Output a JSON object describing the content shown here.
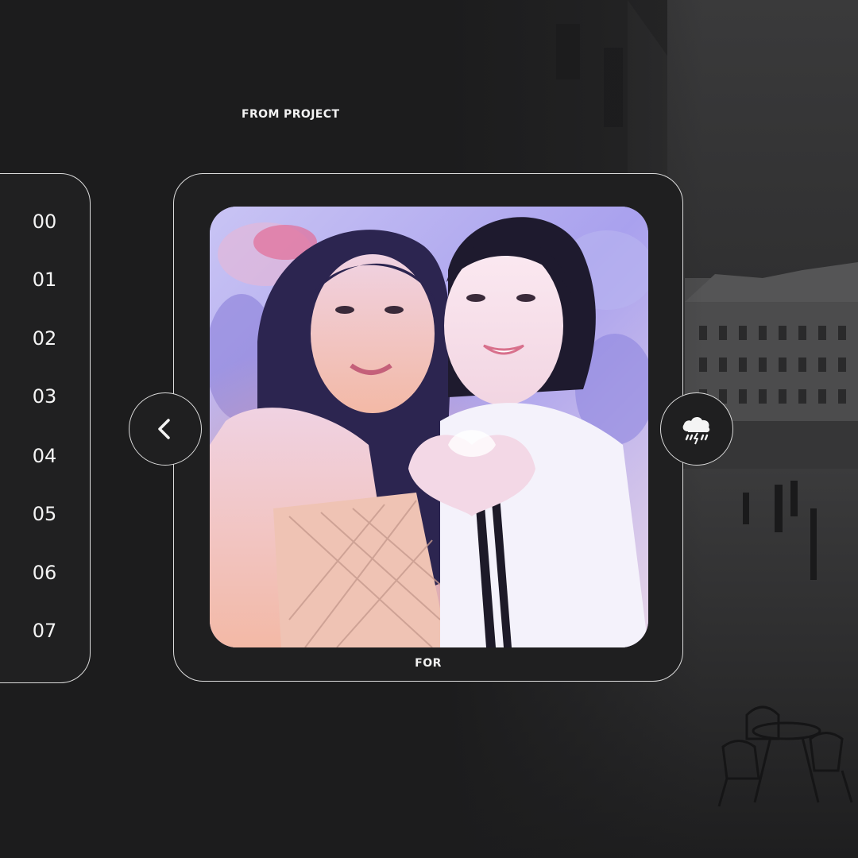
{
  "header": {
    "title": "FROM PROJECT"
  },
  "number_list": {
    "items": [
      "00",
      "01",
      "02",
      "03",
      "04",
      "05",
      "06",
      "07"
    ],
    "active_index": 1
  },
  "card": {
    "caption": "FOR"
  },
  "icons": {
    "prev": "chevron-left-icon",
    "weather": "rain-thunder-cloud-icon"
  },
  "colors": {
    "background": "#1c1c1d",
    "border": "#dcdcdc",
    "active_pill": "#6e6e6e",
    "text": "#f4f4f4"
  }
}
